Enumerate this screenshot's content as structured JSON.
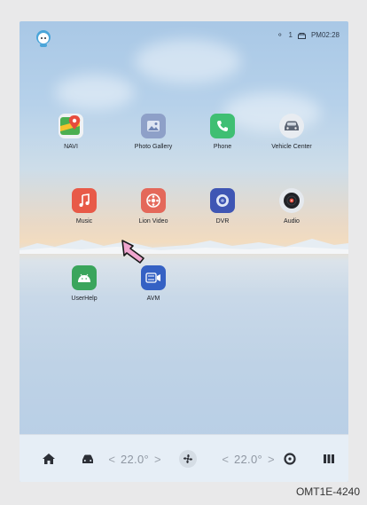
{
  "status": {
    "notifications": "1",
    "time": "PM02:28"
  },
  "apps": [
    {
      "label": "NAVI",
      "icon": "navi-icon",
      "color": "#f2f2f2"
    },
    {
      "label": "Photo Gallery",
      "icon": "photo-gallery-icon",
      "color": "#8ea0c8"
    },
    {
      "label": "Phone",
      "icon": "phone-icon",
      "color": "#3fbf73"
    },
    {
      "label": "Vehicle Center",
      "icon": "vehicle-center-icon",
      "color": "#9aa6b6"
    },
    {
      "label": "Music",
      "icon": "music-icon",
      "color": "#e85a48"
    },
    {
      "label": "Lion Video",
      "icon": "lion-video-icon",
      "color": "#e4685a"
    },
    {
      "label": "DVR",
      "icon": "dvr-icon",
      "color": "#3f56b4"
    },
    {
      "label": "Audio",
      "icon": "audio-icon",
      "color": "#2b2d33"
    },
    {
      "label": "UserHelp",
      "icon": "userhelp-icon",
      "color": "#3aa55c"
    },
    {
      "label": "AVM",
      "icon": "avm-icon",
      "color": "#3561c4"
    }
  ],
  "dock": {
    "left_temp": "22.0°",
    "right_temp": "22.0°",
    "left_chevron": "<",
    "right_chevron": ">"
  },
  "caption": "OMT1E-4240",
  "colors": {
    "arrow": "#f0a6cf",
    "arrow_outline": "#1a1a1a"
  }
}
